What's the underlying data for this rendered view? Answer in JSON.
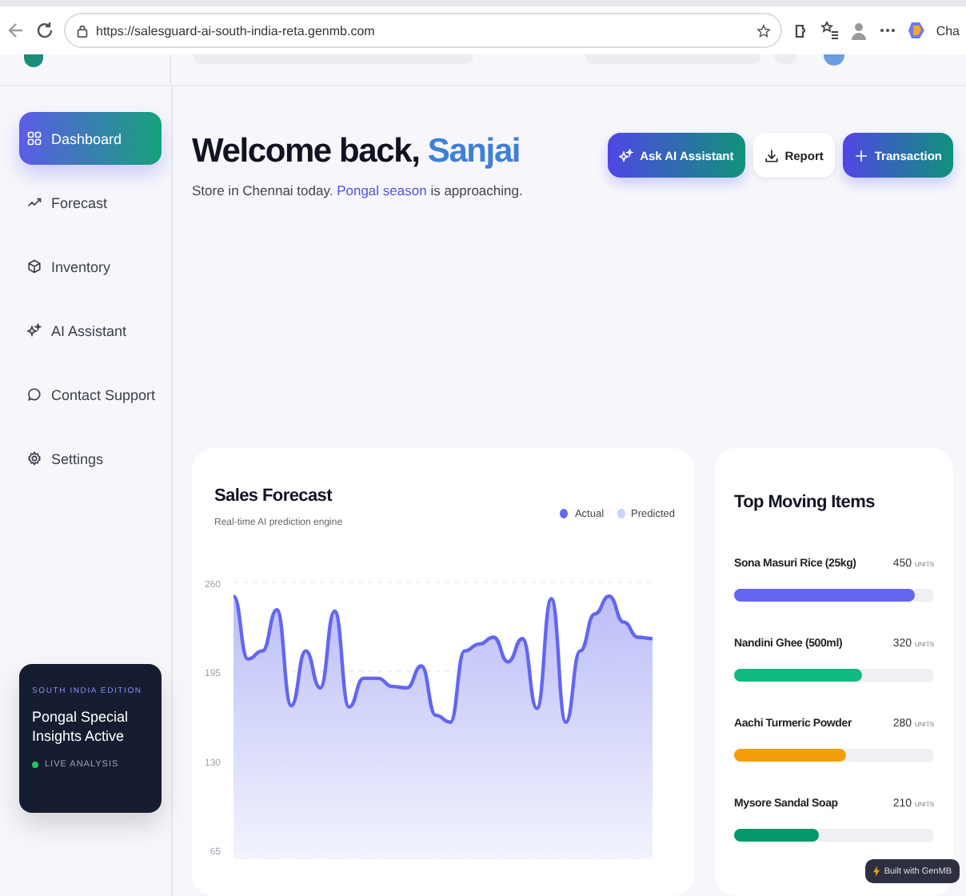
{
  "browser": {
    "url": "https://salesguard-ai-south-india-reta.genmb.com",
    "profile_label": "Cha"
  },
  "sidebar": {
    "items": [
      {
        "label": "Dashboard",
        "selected": true
      },
      {
        "label": "Forecast",
        "selected": false
      },
      {
        "label": "Inventory",
        "selected": false
      },
      {
        "label": "AI Assistant",
        "selected": false
      },
      {
        "label": "Contact Support",
        "selected": false
      },
      {
        "label": "Settings",
        "selected": false
      }
    ],
    "promo": {
      "eyebrow": "SOUTH INDIA EDITION",
      "title": "Pongal Special Insights Active",
      "status": "LIVE ANALYSIS"
    }
  },
  "header": {
    "greeting": "Welcome back,",
    "name": "Sanjai",
    "subtitle": "Store in Chennai today. **Pongal season** is approaching."
  },
  "actions": [
    {
      "label": "Ask AI Assistant",
      "kind": "gradient"
    },
    {
      "label": "Report",
      "kind": "plain"
    },
    {
      "label": "Transaction",
      "kind": "gradient"
    }
  ],
  "sales_forecast": {
    "title": "Sales Forecast",
    "subtitle": "Real-time AI prediction engine",
    "extra_legend": [
      {
        "label": "Predicted",
        "color": "#c7d2fe"
      }
    ],
    "chart_data": {
      "type": "area",
      "ylim": [
        65,
        260
      ],
      "yticks": [
        65,
        130,
        195,
        260
      ],
      "series": [
        {
          "name": "Actual",
          "color": "#6366f1",
          "values": [
            250,
            204,
            210,
            240,
            170,
            210,
            183,
            239,
            169,
            190,
            190,
            184,
            183,
            199,
            163,
            158,
            210,
            215,
            220,
            202,
            219,
            168,
            248,
            158,
            210,
            237,
            250,
            231,
            220,
            219
          ]
        }
      ]
    }
  },
  "top_items": {
    "title": "Top Moving Items",
    "items": [
      {
        "name": "Sona Masuri Rice (25kg)",
        "count": "450",
        "unit": "UNITS",
        "level": 0.9,
        "color": "#6366f1"
      },
      {
        "name": "Nandini Ghee (500ml)",
        "count": "320",
        "unit": "UNITS",
        "level": 0.64,
        "color": "#10b981"
      },
      {
        "name": "Aachi Turmeric Powder",
        "count": "280",
        "unit": "UNITS",
        "level": 0.56,
        "color": "#f59e0b"
      },
      {
        "name": "Mysore Sandal Soap",
        "count": "210",
        "unit": "UNITS",
        "level": 0.42,
        "color": "#059669"
      }
    ]
  },
  "badge": {
    "label": "Built with GenMB"
  }
}
